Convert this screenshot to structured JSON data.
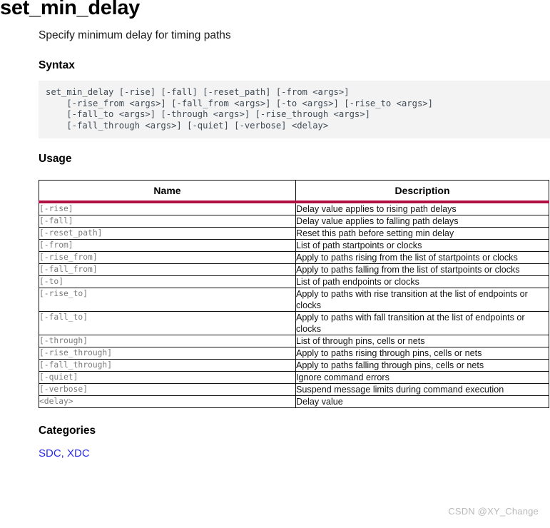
{
  "document": {
    "title": "set_min_delay",
    "subtitle": "Specify minimum delay for timing paths"
  },
  "syntax": {
    "heading": "Syntax",
    "code": "set_min_delay [-rise] [-fall] [-reset_path] [-from <args>]\n    [-rise_from <args>] [-fall_from <args>] [-to <args>] [-rise_to <args>]\n    [-fall_to <args>] [-through <args>] [-rise_through <args>]\n    [-fall_through <args>] [-quiet] [-verbose] <delay>"
  },
  "usage": {
    "heading": "Usage",
    "columns": [
      "Name",
      "Description"
    ],
    "rows": [
      {
        "name": "[-rise]",
        "description": "Delay value applies to rising path delays"
      },
      {
        "name": "[-fall]",
        "description": "Delay value applies to falling path delays"
      },
      {
        "name": "[-reset_path]",
        "description": "Reset this path before setting min delay"
      },
      {
        "name": "[-from]",
        "description": "List of path startpoints or clocks"
      },
      {
        "name": "[-rise_from]",
        "description": "Apply to paths rising from the list of startpoints or clocks"
      },
      {
        "name": "[-fall_from]",
        "description": "Apply to paths falling from the list of startpoints or clocks"
      },
      {
        "name": "[-to]",
        "description": "List of path endpoints or clocks"
      },
      {
        "name": "[-rise_to]",
        "description": "Apply to paths with rise transition at the list of endpoints or clocks"
      },
      {
        "name": "[-fall_to]",
        "description": "Apply to paths with fall transition at the list of endpoints or clocks"
      },
      {
        "name": "[-through]",
        "description": "List of through pins, cells or nets"
      },
      {
        "name": "[-rise_through]",
        "description": "Apply to paths rising through pins, cells or nets"
      },
      {
        "name": "[-fall_through]",
        "description": "Apply to paths falling through pins, cells or nets"
      },
      {
        "name": "[-quiet]",
        "description": "Ignore command errors"
      },
      {
        "name": "[-verbose]",
        "description": "Suspend message limits during command execution"
      },
      {
        "name": "<delay>",
        "description": "Delay value"
      }
    ]
  },
  "categories": {
    "heading": "Categories",
    "links": [
      "SDC",
      "XDC"
    ],
    "separator": ", "
  },
  "watermark": {
    "text": "CSDN @XY_Change"
  },
  "colors": {
    "header_rule": "#b20f42",
    "link": "#2b2bee",
    "code_background": "#f3f3f3",
    "code_text": "#3f4a55",
    "name_cell_text": "#7a7a7a",
    "watermark": "#b9b9b9"
  }
}
